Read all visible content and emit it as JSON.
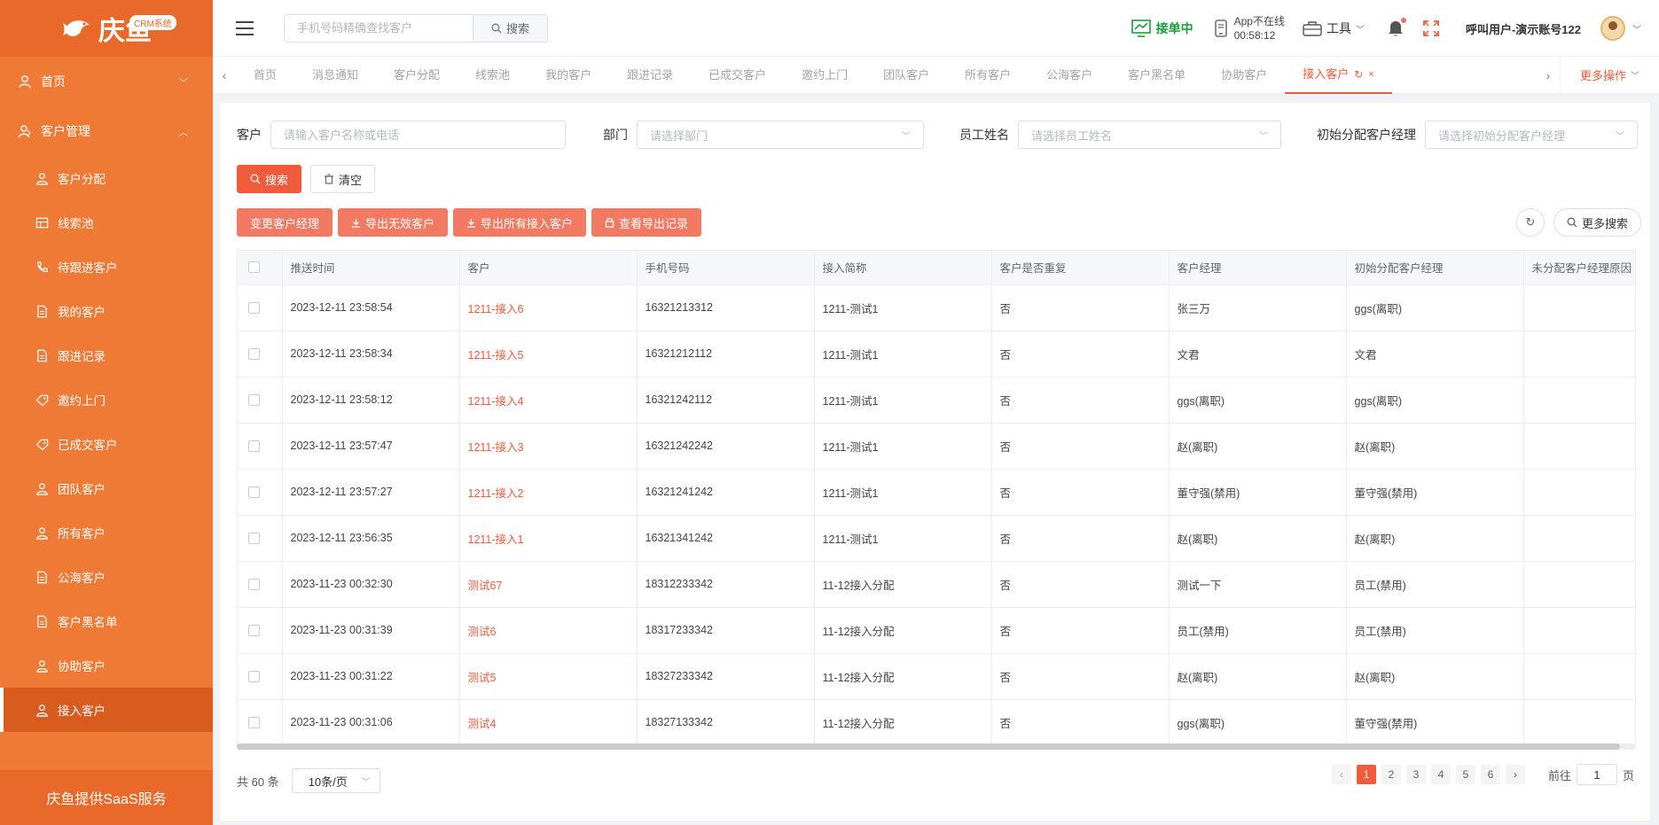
{
  "brand": {
    "name": "庆鱼",
    "badge": "CRM系统",
    "footer": "庆鱼提供SaaS服务"
  },
  "colors": {
    "sidebar": "#ef7a35",
    "accent": "#ef5b3b",
    "status_green": "#1a9e3b"
  },
  "sidebar": {
    "home": {
      "label": "首页",
      "icon": "user-icon"
    },
    "group": {
      "label": "客户管理",
      "icon": "customer-icon"
    },
    "items": [
      {
        "label": "客户分配",
        "icon": "person-icon"
      },
      {
        "label": "线索池",
        "icon": "table-icon"
      },
      {
        "label": "待跟进客户",
        "icon": "phone-icon"
      },
      {
        "label": "我的客户",
        "icon": "document-icon"
      },
      {
        "label": "跟进记录",
        "icon": "document-icon"
      },
      {
        "label": "邀约上门",
        "icon": "tag-icon"
      },
      {
        "label": "已成交客户",
        "icon": "tag-icon"
      },
      {
        "label": "团队客户",
        "icon": "person-icon"
      },
      {
        "label": "所有客户",
        "icon": "person-icon"
      },
      {
        "label": "公海客户",
        "icon": "document-icon"
      },
      {
        "label": "客户黑名单",
        "icon": "document-icon"
      },
      {
        "label": "协助客户",
        "icon": "person-icon"
      },
      {
        "label": "接入客户",
        "icon": "person-icon",
        "active": true
      }
    ]
  },
  "header": {
    "search_placeholder": "手机号码精确查找客户",
    "search_button": "搜索",
    "status": "接单中",
    "app_status_line1": "App不在线",
    "app_status_line2": "00:58:12",
    "tools": "工具",
    "account": "呼叫用户-演示账号122"
  },
  "tabs": {
    "items": [
      "首页",
      "消息通知",
      "客户分配",
      "线索池",
      "我的客户",
      "跟进记录",
      "已成交客户",
      "邀约上门",
      "团队客户",
      "所有客户",
      "公海客户",
      "客户黑名单",
      "协助客户"
    ],
    "active": "接入客户",
    "more": "更多操作"
  },
  "filters": {
    "customer_label": "客户",
    "customer_placeholder": "请输入客户名称或电话",
    "dept_label": "部门",
    "dept_placeholder": "请选择部门",
    "staff_label": "员工姓名",
    "staff_placeholder": "请选择员工姓名",
    "initial_label": "初始分配客户经理",
    "initial_placeholder": "请选择初始分配客户经理",
    "search_btn": "搜索",
    "clear_btn": "清空"
  },
  "actions": {
    "change_manager": "变更客户经理",
    "export_invalid": "导出无效客户",
    "export_all": "导出所有接入客户",
    "view_export": "查看导出记录",
    "more_search": "更多搜索"
  },
  "table": {
    "columns": [
      "推送时间",
      "客户",
      "手机号码",
      "接入简称",
      "客户是否重复",
      "客户经理",
      "初始分配客户经理",
      "未分配客户经理原因"
    ],
    "rows": [
      [
        "2023-12-11 23:58:54",
        "1211-接入6",
        "16321213312",
        "1211-测试1",
        "否",
        "张三万",
        "ggs(离职)",
        ""
      ],
      [
        "2023-12-11 23:58:34",
        "1211-接入5",
        "16321212112",
        "1211-测试1",
        "否",
        "文君",
        "文君",
        ""
      ],
      [
        "2023-12-11 23:58:12",
        "1211-接入4",
        "16321242112",
        "1211-测试1",
        "否",
        "ggs(离职)",
        "ggs(离职)",
        ""
      ],
      [
        "2023-12-11 23:57:47",
        "1211-接入3",
        "16321242242",
        "1211-测试1",
        "否",
        "赵(离职)",
        "赵(离职)",
        ""
      ],
      [
        "2023-12-11 23:57:27",
        "1211-接入2",
        "16321241242",
        "1211-测试1",
        "否",
        "董守强(禁用)",
        "董守强(禁用)",
        ""
      ],
      [
        "2023-12-11 23:56:35",
        "1211-接入1",
        "16321341242",
        "1211-测试1",
        "否",
        "赵(离职)",
        "赵(离职)",
        ""
      ],
      [
        "2023-11-23 00:32:30",
        "测试67",
        "18312233342",
        "11-12接入分配",
        "否",
        "测试一下",
        "员工(禁用)",
        ""
      ],
      [
        "2023-11-23 00:31:39",
        "测试6",
        "18317233342",
        "11-12接入分配",
        "否",
        "员工(禁用)",
        "员工(禁用)",
        ""
      ],
      [
        "2023-11-23 00:31:22",
        "测试5",
        "18327233342",
        "11-12接入分配",
        "否",
        "赵(离职)",
        "赵(离职)",
        ""
      ],
      [
        "2023-11-23 00:31:06",
        "测试4",
        "18327133342",
        "11-12接入分配",
        "否",
        "ggs(离职)",
        "董守强(禁用)",
        ""
      ]
    ]
  },
  "pagination": {
    "total": "共 60 条",
    "page_size": "10条/页",
    "pages": [
      "1",
      "2",
      "3",
      "4",
      "5",
      "6"
    ],
    "current": "1",
    "goto_label": "前往",
    "goto_value": "1",
    "page_unit": "页"
  }
}
